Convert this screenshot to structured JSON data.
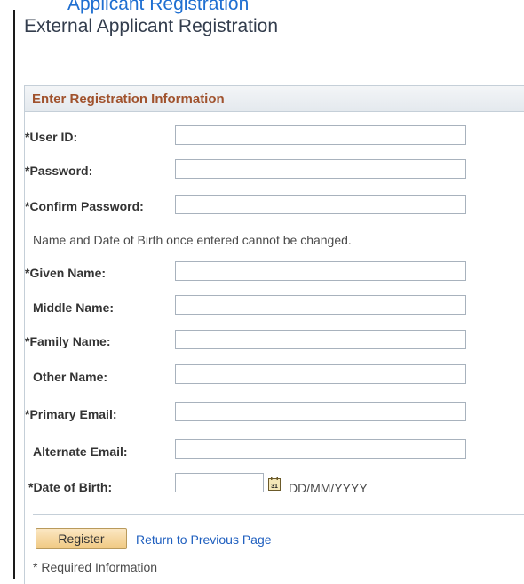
{
  "top_link": "Applicant Registration",
  "page_title": "External Applicant Registration",
  "section_title": "Enter Registration Information",
  "fields": {
    "user_id": {
      "label": "*User ID:",
      "value": ""
    },
    "password": {
      "label": "*Password:",
      "value": ""
    },
    "confirm_password": {
      "label": "*Confirm Password:",
      "value": ""
    },
    "given_name": {
      "label": "*Given Name:",
      "value": ""
    },
    "middle_name": {
      "label": "Middle Name:",
      "value": ""
    },
    "family_name": {
      "label": "*Family Name:",
      "value": ""
    },
    "other_name": {
      "label": "Other Name:",
      "value": ""
    },
    "primary_email": {
      "label": "*Primary Email:",
      "value": ""
    },
    "alternate_email": {
      "label": "Alternate Email:",
      "value": ""
    },
    "date_of_birth": {
      "label": "*Date of Birth:",
      "value": "",
      "format": "DD/MM/YYYY"
    }
  },
  "note": "Name and Date of Birth once entered cannot be changed.",
  "calendar_icon_text": "31",
  "register_button": "Register",
  "return_link": "Return to Previous Page",
  "required_note": "* Required Information",
  "colors": {
    "section_title": "#a0522d",
    "link": "#1f5fbf",
    "button": "#f0c982"
  }
}
